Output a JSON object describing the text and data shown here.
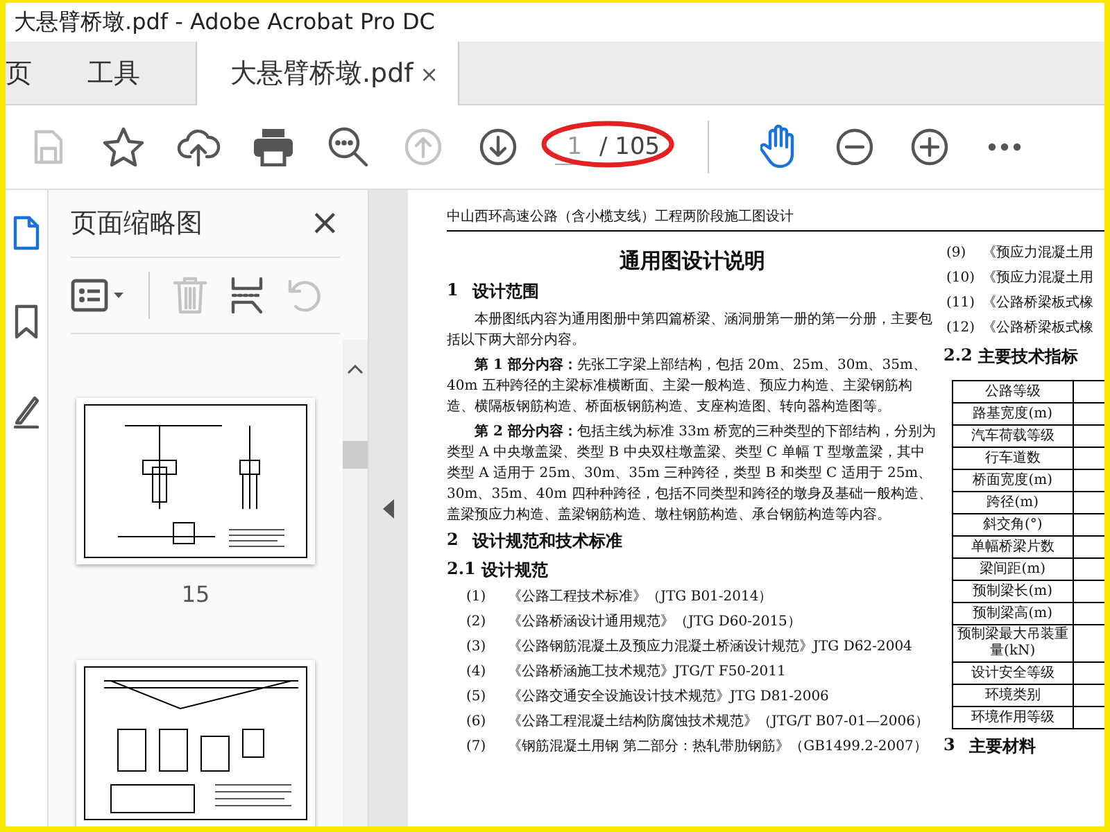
{
  "window": {
    "title": "大悬臂桥墩.pdf - Adobe Acrobat Pro DC"
  },
  "tabs": [
    {
      "label": "页",
      "selected": false
    },
    {
      "label": "工具",
      "selected": false
    },
    {
      "label": "大悬臂桥墩.pdf",
      "selected": true,
      "close": "×"
    }
  ],
  "toolbar": {
    "left": [
      {
        "kind": "save",
        "disabled": true,
        "selected": false
      },
      {
        "kind": "star",
        "disabled": false,
        "selected": false
      },
      {
        "kind": "upload",
        "disabled": false,
        "selected": false
      },
      {
        "kind": "print",
        "disabled": false,
        "selected": false
      },
      {
        "kind": "search",
        "disabled": false,
        "selected": false
      },
      {
        "kind": "prev",
        "disabled": true,
        "selected": false
      },
      {
        "kind": "next",
        "disabled": false,
        "selected": false
      }
    ],
    "page": {
      "value": "1",
      "total": "/ 105",
      "circled": true
    },
    "right": [
      {
        "kind": "hand",
        "disabled": false,
        "selected": true
      },
      {
        "kind": "zoomout",
        "disabled": false,
        "selected": false
      },
      {
        "kind": "zoomin",
        "disabled": false,
        "selected": false
      },
      {
        "kind": "more",
        "disabled": false,
        "selected": false
      }
    ]
  },
  "rail": [
    {
      "kind": "thumbnails",
      "selected": true
    },
    {
      "kind": "bookmarks",
      "selected": false
    },
    {
      "kind": "sign",
      "selected": false
    }
  ],
  "sidebar": {
    "title": "页面缩略图",
    "close": "×",
    "tools": [
      {
        "kind": "options",
        "disabled": false
      },
      {
        "kind": "delete",
        "disabled": true
      },
      {
        "kind": "insert",
        "disabled": false
      },
      {
        "kind": "rotate",
        "disabled": true
      }
    ],
    "thumbnails": [
      {
        "kind": "elevation",
        "label": "15"
      },
      {
        "kind": "detail"
      }
    ]
  },
  "document": {
    "header": "中山西环高速公路（含小榄支线）工程两阶段施工图设计",
    "title": "通用图设计说明",
    "left": [
      {
        "kind": "heading",
        "number": "1",
        "text": "设计范围"
      },
      {
        "kind": "para",
        "text": "本册图纸内容为通用图册中第四篇桥梁、涵洞册第一册的第一分册，主要包括以下两大部分内容。"
      },
      {
        "kind": "para",
        "text": "**第 1 部分内容：**先张工字梁上部结构，包括 20m、25m、30m、35m、40m 五种跨径的主梁标准横断面、主梁一般构造、预应力构造、主梁钢筋构造、横隔板钢筋构造、桥面板钢筋构造、支座构造图、转向器构造图等。"
      },
      {
        "kind": "para",
        "text": "**第 2 部分内容：**包括主线为标准 33m 桥宽的三种类型的下部结构，分别为类型 A 中央墩盖梁、类型 B 中央双柱墩盖梁、类型 C 单幅 T 型墩盖梁，其中类型 A 适用于 25m、30m、35m 三种跨径，类型 B 和类型 C 适用于 25m、30m、35m、40m 四种种跨径，包括不同类型和跨径的墩身及基础一般构造、盖梁预应力构造、盖梁钢筋构造、墩柱钢筋构造、承台钢筋构造等内容。"
      },
      {
        "kind": "heading",
        "number": "2",
        "text": "设计规范和技术标准"
      },
      {
        "kind": "subheading",
        "number": "2.1",
        "text": "设计规范"
      },
      {
        "kind": "item",
        "number": "(1)",
        "text": "《公路工程技术标准》（JTG B01-2014）"
      },
      {
        "kind": "item",
        "number": "(2)",
        "text": "《公路桥涵设计通用规范》（JTG D60-2015）"
      },
      {
        "kind": "item",
        "number": "(3)",
        "text": "《公路钢筋混凝土及预应力混凝土桥涵设计规范》JTG D62-2004"
      },
      {
        "kind": "item",
        "number": "(4)",
        "text": "《公路桥涵施工技术规范》JTG/T F50-2011"
      },
      {
        "kind": "item",
        "number": "(5)",
        "text": "《公路交通安全设施设计技术规范》JTG D81-2006"
      },
      {
        "kind": "item",
        "number": "(6)",
        "text": "《公路工程混凝土结构防腐蚀技术规范》（JTG/T B07-01—2006）"
      },
      {
        "kind": "item",
        "number": "(7)",
        "text": "《钢筋混凝土用钢 第二部分：热轧带肋钢筋》（GB1499.2-2007）"
      }
    ],
    "right": [
      {
        "kind": "item",
        "number": "(9)",
        "text": "《预应力混凝土用"
      },
      {
        "kind": "item",
        "number": "(10)",
        "text": "《预应力混凝土用"
      },
      {
        "kind": "item",
        "number": "(11)",
        "text": "《公路桥梁板式橡"
      },
      {
        "kind": "item",
        "number": "(12)",
        "text": "《公路桥梁板式橡"
      },
      {
        "kind": "subheading",
        "number": "2.2",
        "text": "主要技术指标"
      },
      {
        "kind": "table",
        "rows": [
          "公路等级",
          "路基宽度(m)",
          "汽车荷载等级",
          "行车道数",
          "桥面宽度(m)",
          "跨径(m)",
          "斜交角(°)",
          "单幅桥梁片数",
          "梁间距(m)",
          "预制梁长(m)",
          "预制梁高(m)",
          "预制梁最大吊装重量(kN)",
          "设计安全等级",
          "环境类别",
          "环境作用等级"
        ]
      },
      {
        "kind": "heading",
        "number": "3",
        "text": "主要材料"
      }
    ]
  }
}
